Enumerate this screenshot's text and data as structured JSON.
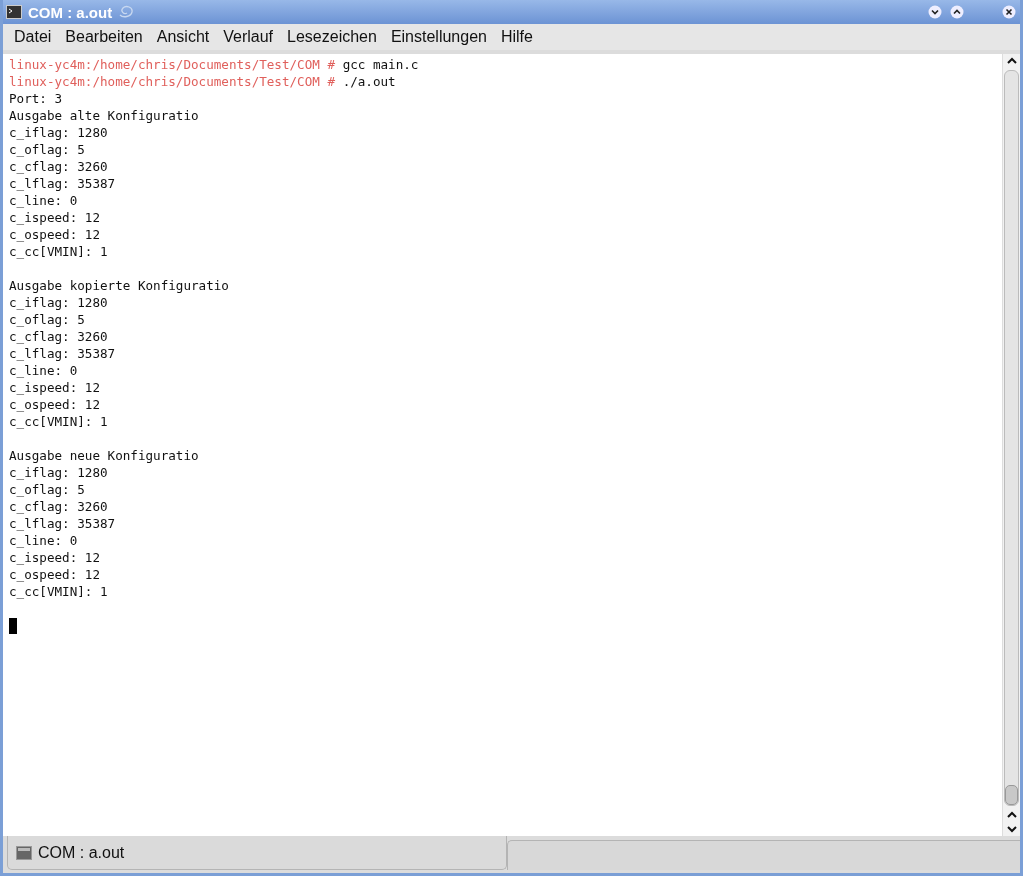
{
  "window": {
    "title": "COM : a.out"
  },
  "menu": [
    "Datei",
    "Bearbeiten",
    "Ansicht",
    "Verlauf",
    "Lesezeichen",
    "Einstellungen",
    "Hilfe"
  ],
  "terminal": {
    "lines": [
      {
        "kind": "prompt",
        "prompt": "linux-yc4m:/home/chris/Documents/Test/COM #",
        "command": "gcc main.c"
      },
      {
        "kind": "prompt",
        "prompt": "linux-yc4m:/home/chris/Documents/Test/COM #",
        "command": "./a.out"
      },
      {
        "kind": "output",
        "text": "Port: 3"
      },
      {
        "kind": "output",
        "text": "Ausgabe alte Konfiguratio"
      },
      {
        "kind": "output",
        "text": "c_iflag: 1280"
      },
      {
        "kind": "output",
        "text": "c_oflag: 5"
      },
      {
        "kind": "output",
        "text": "c_cflag: 3260"
      },
      {
        "kind": "output",
        "text": "c_lflag: 35387"
      },
      {
        "kind": "output",
        "text": "c_line: 0"
      },
      {
        "kind": "output",
        "text": "c_ispeed: 12"
      },
      {
        "kind": "output",
        "text": "c_ospeed: 12"
      },
      {
        "kind": "output",
        "text": "c_cc[VMIN]: 1"
      },
      {
        "kind": "blank"
      },
      {
        "kind": "output",
        "text": "Ausgabe kopierte Konfiguratio"
      },
      {
        "kind": "output",
        "text": "c_iflag: 1280"
      },
      {
        "kind": "output",
        "text": "c_oflag: 5"
      },
      {
        "kind": "output",
        "text": "c_cflag: 3260"
      },
      {
        "kind": "output",
        "text": "c_lflag: 35387"
      },
      {
        "kind": "output",
        "text": "c_line: 0"
      },
      {
        "kind": "output",
        "text": "c_ispeed: 12"
      },
      {
        "kind": "output",
        "text": "c_ospeed: 12"
      },
      {
        "kind": "output",
        "text": "c_cc[VMIN]: 1"
      },
      {
        "kind": "blank"
      },
      {
        "kind": "output",
        "text": "Ausgabe neue Konfiguratio"
      },
      {
        "kind": "output",
        "text": "c_iflag: 1280"
      },
      {
        "kind": "output",
        "text": "c_oflag: 5"
      },
      {
        "kind": "output",
        "text": "c_cflag: 3260"
      },
      {
        "kind": "output",
        "text": "c_lflag: 35387"
      },
      {
        "kind": "output",
        "text": "c_line: 0"
      },
      {
        "kind": "output",
        "text": "c_ispeed: 12"
      },
      {
        "kind": "output",
        "text": "c_ospeed: 12"
      },
      {
        "kind": "output",
        "text": "c_cc[VMIN]: 1"
      },
      {
        "kind": "blank"
      },
      {
        "kind": "cursor"
      }
    ]
  },
  "tabs": [
    {
      "label": "COM : a.out",
      "selected": true
    }
  ]
}
